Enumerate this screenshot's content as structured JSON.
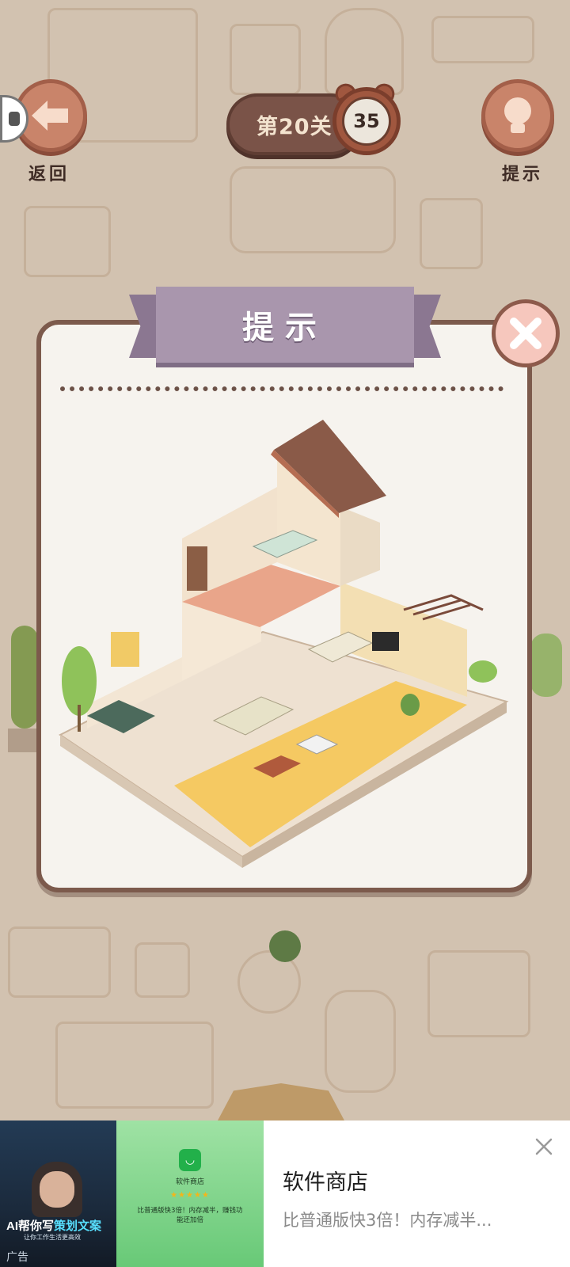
{
  "hud": {
    "back_label": "返回",
    "level_label": "第20关",
    "timer_value": "35",
    "hint_label": "提示"
  },
  "dialog": {
    "title": "提示",
    "image_description_icon": "house-illustration"
  },
  "ad": {
    "title": "软件商店",
    "subtitle": "比普通版快3倍！内存减半...",
    "tag": "广告",
    "thumb1_text_a": "AI帮你写",
    "thumb1_text_b": "策划文案",
    "thumb1_sub": "让你工作生活更高效",
    "thumb2_name": "软件商店",
    "thumb2_stars": "★★★★★",
    "thumb2_desc": "比普通版快3倍！内存减半，赚钱功能还加倍"
  },
  "colors": {
    "accent": "#a996ad",
    "button": "#c9846a",
    "dialog_border": "#7c5a4c"
  }
}
